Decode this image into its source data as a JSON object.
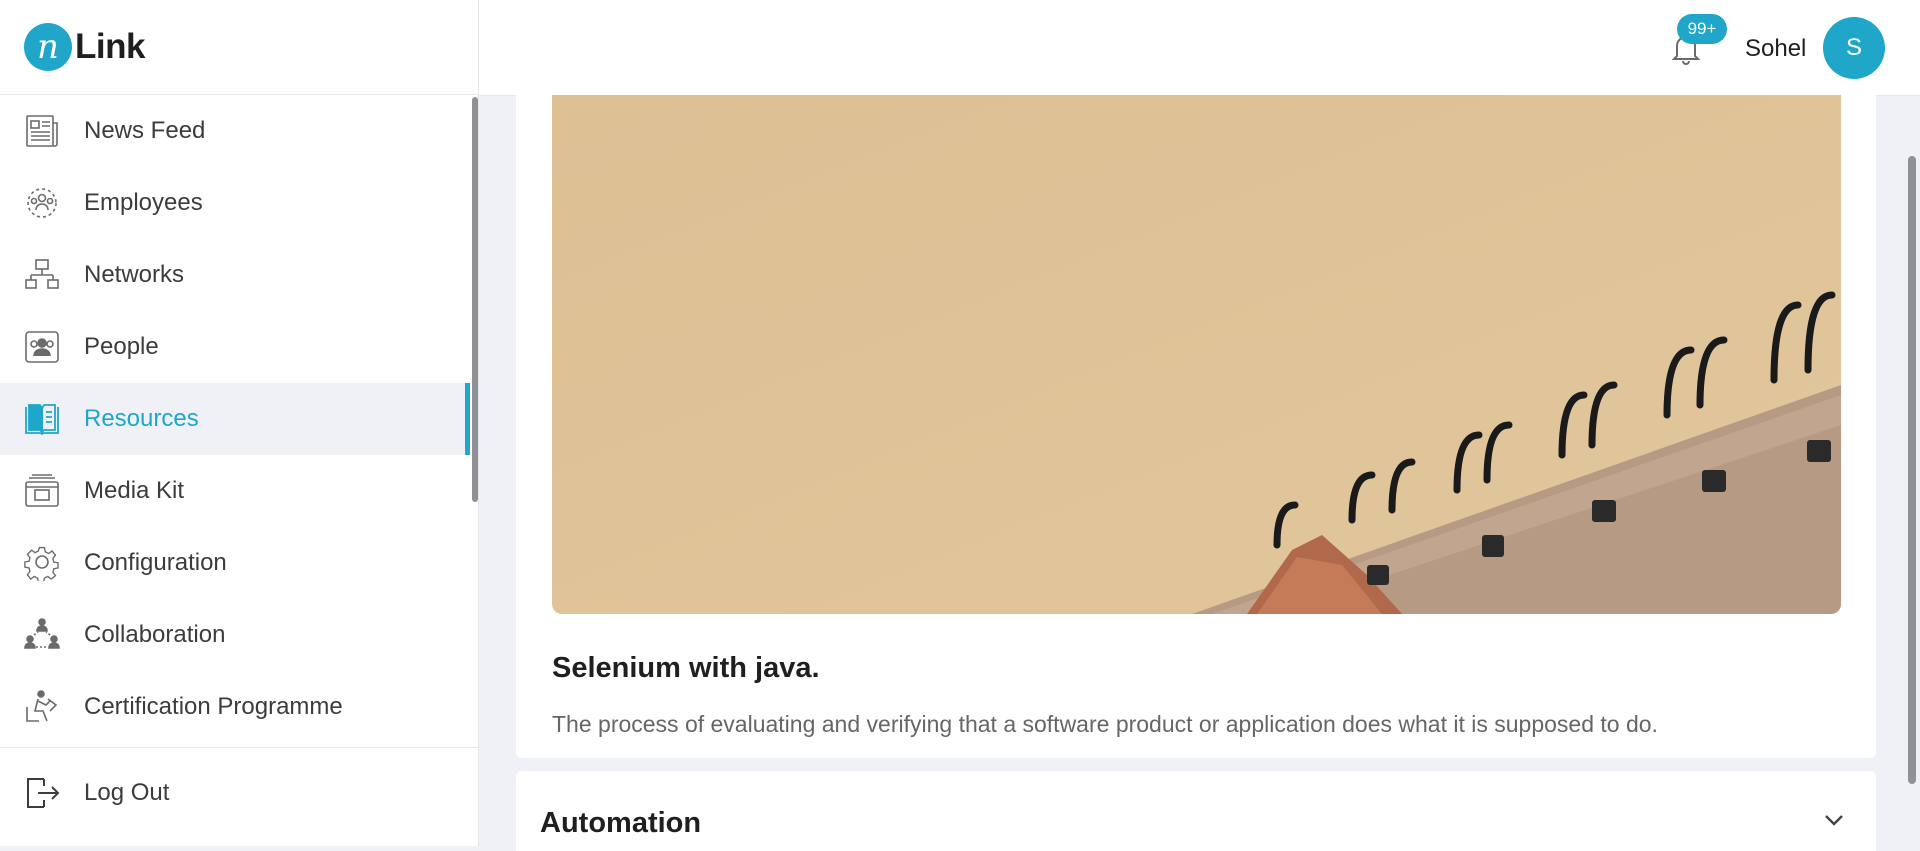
{
  "app": {
    "logo_mark": "n",
    "logo_text": "Link"
  },
  "sidebar": {
    "items": [
      {
        "label": "News Feed",
        "icon": "newspaper-icon",
        "active": false
      },
      {
        "label": "Employees",
        "icon": "employees-group-icon",
        "active": false
      },
      {
        "label": "Networks",
        "icon": "network-icon",
        "active": false
      },
      {
        "label": "People",
        "icon": "people-icon",
        "active": false
      },
      {
        "label": "Resources",
        "icon": "book-icon",
        "active": true
      },
      {
        "label": "Media Kit",
        "icon": "media-kit-icon",
        "active": false
      },
      {
        "label": "Configuration",
        "icon": "gear-icon",
        "active": false
      },
      {
        "label": "Collaboration",
        "icon": "collaboration-icon",
        "active": false
      },
      {
        "label": "Certification Programme",
        "icon": "reading-person-icon",
        "active": false
      }
    ],
    "logout_label": "Log Out"
  },
  "header": {
    "notification_count": "99+",
    "user_name": "Sohel",
    "avatar_initial": "S"
  },
  "resource_card": {
    "title": "Selenium with java.",
    "description": "The process of evaluating and verifying that a software product or application does what it is supposed to do."
  },
  "accordion": {
    "title": "Automation"
  },
  "colors": {
    "accent": "#1fa6c9",
    "background": "#f0f1f6"
  }
}
